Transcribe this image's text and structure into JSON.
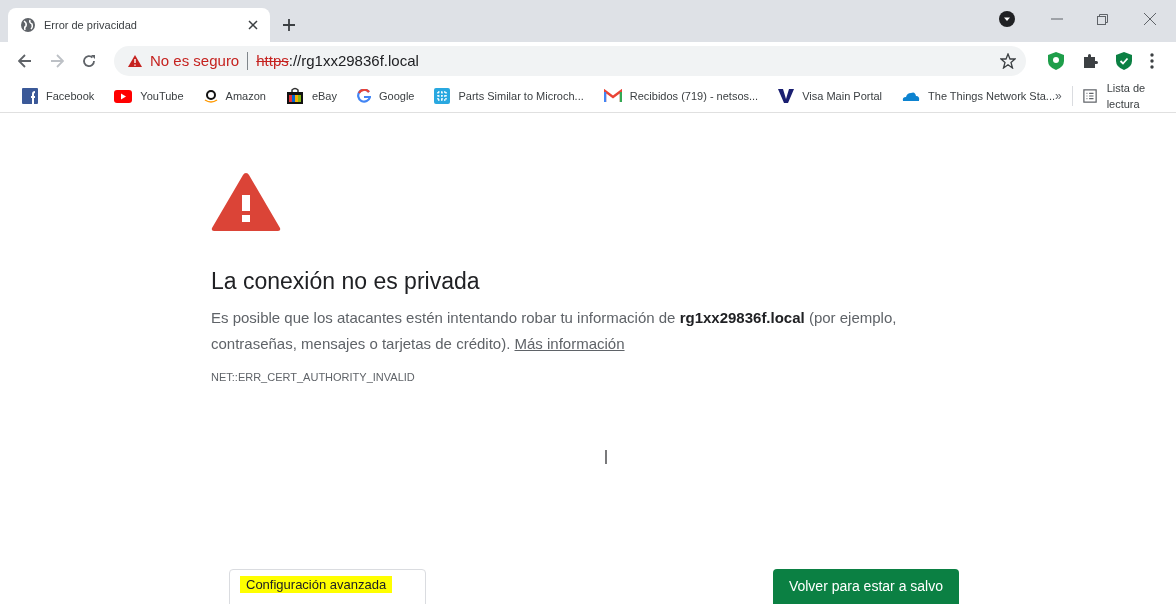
{
  "tab": {
    "title": "Error de privacidad",
    "selected": true
  },
  "address_bar": {
    "security_label": "No es seguro",
    "scheme": "https",
    "rest": "://rg1xx29836f.local"
  },
  "bookmarks": [
    {
      "label": "Facebook"
    },
    {
      "label": "YouTube"
    },
    {
      "label": "Amazon"
    },
    {
      "label": "eBay"
    },
    {
      "label": "Google"
    },
    {
      "label": "Parts Similar to Microch..."
    },
    {
      "label": "Recibidos (719) - netsos..."
    },
    {
      "label": "Visa Main Portal"
    },
    {
      "label": "The Things Network Sta..."
    }
  ],
  "more_bookmarks": "»",
  "reading_list": "Lista de lectura",
  "page": {
    "heading": "La conexión no es privada",
    "description": "Es posible que los atacantes estén intentando robar tu información de **rg1xx29836f.local** (por ejemplo, contraseñas, mensajes o tarjetas de crédito).",
    "link": "Más información",
    "error_code": "NET::ERR_CERT_AUTHORITY_INVALID",
    "advanced_button": {
      "label": "Configuración avanzada",
      "highlighted": true
    },
    "back_button": "Volver para estar a salvo"
  }
}
